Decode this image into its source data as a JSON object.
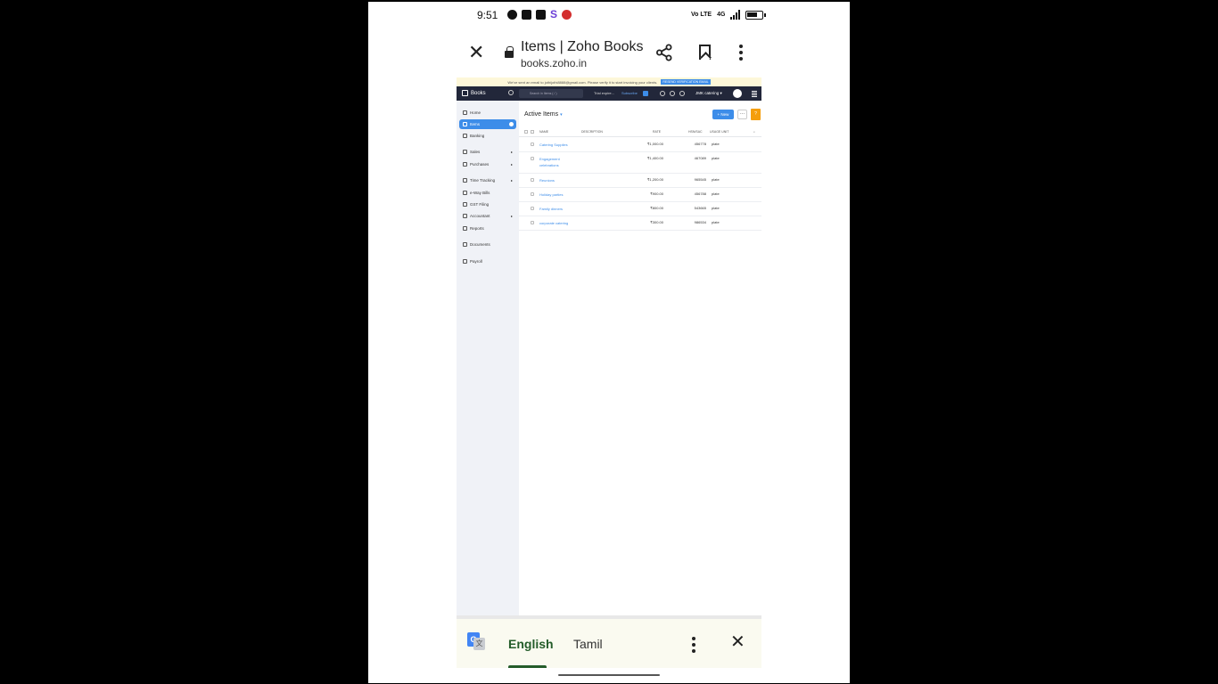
{
  "status_bar": {
    "time": "9:51",
    "left_icons": [
      "message-icon",
      "snapchat-icon",
      "youtube-icon",
      "s-app-icon",
      "jio-icon"
    ],
    "s_glyph": "S",
    "volte": "Vo LTE",
    "network": "4G"
  },
  "custom_tab": {
    "title": "Items | Zoho Books",
    "url": "books.zoho.in"
  },
  "banner": {
    "text": "We've sent an email to jothijothi8888@gmail.com. Please verify it to start invoicing your clients.",
    "button": "RESEND VERIFICATION EMAIL"
  },
  "topbar": {
    "app_name": "Books",
    "search_placeholder": "Search in Items ( / )",
    "trial": "Trial expire...",
    "subscribe": "Subscribe",
    "org": "JMK catering ▾"
  },
  "sidebar": {
    "items": [
      {
        "label": "Home"
      },
      {
        "label": "Items"
      },
      {
        "label": "Banking"
      },
      {
        "label": "Sales"
      },
      {
        "label": "Purchases"
      },
      {
        "label": "Time Tracking"
      },
      {
        "label": "e-Way Bills"
      },
      {
        "label": "GST Filing"
      },
      {
        "label": "Accountant"
      },
      {
        "label": "Reports"
      },
      {
        "label": "Documents"
      },
      {
        "label": "Payroll"
      }
    ]
  },
  "main": {
    "heading": "Active Items",
    "new_button": "+ New",
    "more_button": "···",
    "help_button": "?",
    "columns": [
      "NAME",
      "DESCRIPTION",
      "RATE",
      "HSN/SAC",
      "USAGE UNIT"
    ],
    "rows": [
      {
        "name": "Catering Supplies",
        "rate": "₹1,000.00",
        "hsn": "456778",
        "unit": "plate"
      },
      {
        "name": "Engagement celebrations",
        "rate": "₹1,400.00",
        "hsn": "467089",
        "unit": "plate"
      },
      {
        "name": "Reunions",
        "rate": "₹1,200.00",
        "hsn": "965545",
        "unit": "plate"
      },
      {
        "name": "Holiday parties",
        "rate": "₹900.00",
        "hsn": "456788",
        "unit": "plate"
      },
      {
        "name": "Family dinners",
        "rate": "₹800.00",
        "hsn": "543665",
        "unit": "plate"
      },
      {
        "name": "corporate catering",
        "rate": "₹300.00",
        "hsn": "986534",
        "unit": "plate"
      }
    ]
  },
  "translate_bar": {
    "source_lang": "English",
    "target_lang": "Tamil"
  },
  "colors": {
    "accent": "#3d8de9",
    "topbar": "#22273a",
    "translate_active": "#245c2a"
  }
}
